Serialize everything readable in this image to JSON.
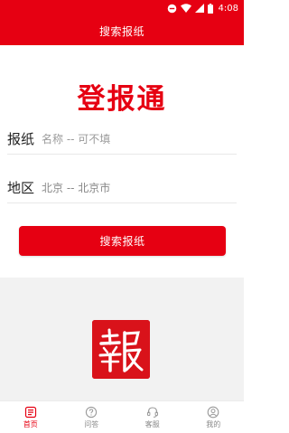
{
  "status_bar": {
    "time": "4:08",
    "icons": [
      "minus-circle-icon",
      "wifi-icon",
      "signal-icon",
      "battery-icon"
    ]
  },
  "app_bar": {
    "title": "搜索报纸"
  },
  "main": {
    "logo_text": "登报通",
    "newspaper": {
      "label": "报纸",
      "placeholder": "名称 -- 可不填"
    },
    "region": {
      "label": "地区",
      "value": "北京 -- 北京市"
    },
    "search_button_label": "搜索报纸",
    "banner_icon": "newspaper-seal-icon"
  },
  "bottom_nav": {
    "items": [
      {
        "label": "首页",
        "icon": "home-newspaper-icon",
        "active": true
      },
      {
        "label": "问答",
        "icon": "question-bubble-icon",
        "active": false
      },
      {
        "label": "客服",
        "icon": "headset-icon",
        "active": false
      },
      {
        "label": "我的",
        "icon": "user-icon",
        "active": false
      }
    ]
  },
  "colors": {
    "accent": "#e60012",
    "seal": "#d9121a",
    "background_gray": "#f2f2f2"
  }
}
